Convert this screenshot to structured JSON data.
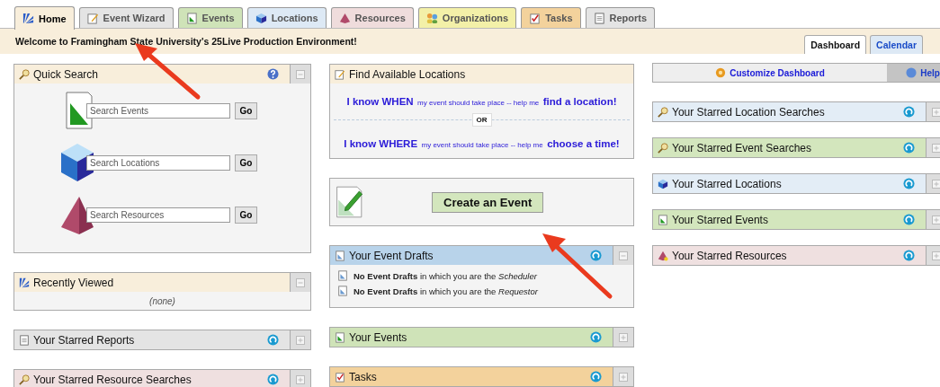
{
  "tabs": [
    {
      "label": "Home",
      "selected": true,
      "color": "#f8eedb"
    },
    {
      "label": "Event Wizard",
      "selected": false,
      "color": "#e4e4e4"
    },
    {
      "label": "Events",
      "selected": false,
      "color": "#cfe3b8"
    },
    {
      "label": "Locations",
      "selected": false,
      "color": "#dde9f5"
    },
    {
      "label": "Resources",
      "selected": false,
      "color": "#efdcdc"
    },
    {
      "label": "Organizations",
      "selected": false,
      "color": "#f3f0a8"
    },
    {
      "label": "Tasks",
      "selected": false,
      "color": "#f3d29c"
    },
    {
      "label": "Reports",
      "selected": false,
      "color": "#e4e4e4"
    }
  ],
  "welcome": "Welcome to Framingham State University's 25Live Production Environment!",
  "view_tabs": [
    {
      "label": "Dashboard",
      "selected": true
    },
    {
      "label": "Calendar",
      "selected": false
    }
  ],
  "columns": [
    {
      "panels": [
        {
          "kind": "search",
          "title": "Quick Search",
          "color": "#f8eedb",
          "expanded": true,
          "searches": [
            {
              "placeholder": "Search Events",
              "button": "Go"
            },
            {
              "placeholder": "Search Locations",
              "button": "Go"
            },
            {
              "placeholder": "Search Resources",
              "button": "Go"
            }
          ]
        },
        {
          "kind": "note",
          "title": "Recently Viewed",
          "color": "#f8eedb",
          "expanded": true,
          "note": "(none)"
        },
        {
          "kind": "collapsed",
          "title": "Your Starred Reports",
          "color": "#e4e4e4",
          "expanded": false
        },
        {
          "kind": "collapsed",
          "title": "Your Starred Resource Searches",
          "color": "#efe0e0",
          "expanded": false
        }
      ]
    },
    {
      "panels": [
        {
          "kind": "find",
          "title": "Find Available Locations",
          "color": "#f8eedb",
          "lines": [
            {
              "lead": "I know WHEN",
              "middle": "my event should take place -- help me",
              "link": "find a location!"
            },
            {
              "lead": "I know WHERE",
              "middle": "my event should take place -- help me",
              "link": "choose a time!"
            }
          ],
          "divider": "OR"
        },
        {
          "kind": "create",
          "button": "Create an Event"
        },
        {
          "kind": "list",
          "title": "Your Event Drafts",
          "color": "#b8d3ea",
          "expanded": true,
          "items": [
            "**No Event Drafts** in which you are the *Scheduler*",
            "**No Event Drafts** in which you are the *Requestor*"
          ]
        },
        {
          "kind": "collapsed",
          "title": "Your Events",
          "color": "#cfe3b8",
          "expanded": false
        },
        {
          "kind": "collapsed",
          "title": "Tasks",
          "color": "#f3d29c",
          "expanded": false
        }
      ]
    },
    {
      "toolbar": {
        "customize": "Customize Dashboard",
        "help": "Help"
      },
      "panels": [
        {
          "kind": "collapsed",
          "title": "Your Starred Location Searches",
          "color": "#e3edf6",
          "expanded": false
        },
        {
          "kind": "collapsed",
          "title": "Your Starred Event Searches",
          "color": "#d3e6bd",
          "expanded": false
        },
        {
          "kind": "collapsed",
          "title": "Your Starred Locations",
          "color": "#e3edf6",
          "expanded": false
        },
        {
          "kind": "collapsed",
          "title": "Your Starred Events",
          "color": "#d3e6bd",
          "expanded": false
        },
        {
          "kind": "collapsed",
          "title": "Your Starred Resources",
          "color": "#efe0e0",
          "expanded": false
        }
      ]
    }
  ]
}
